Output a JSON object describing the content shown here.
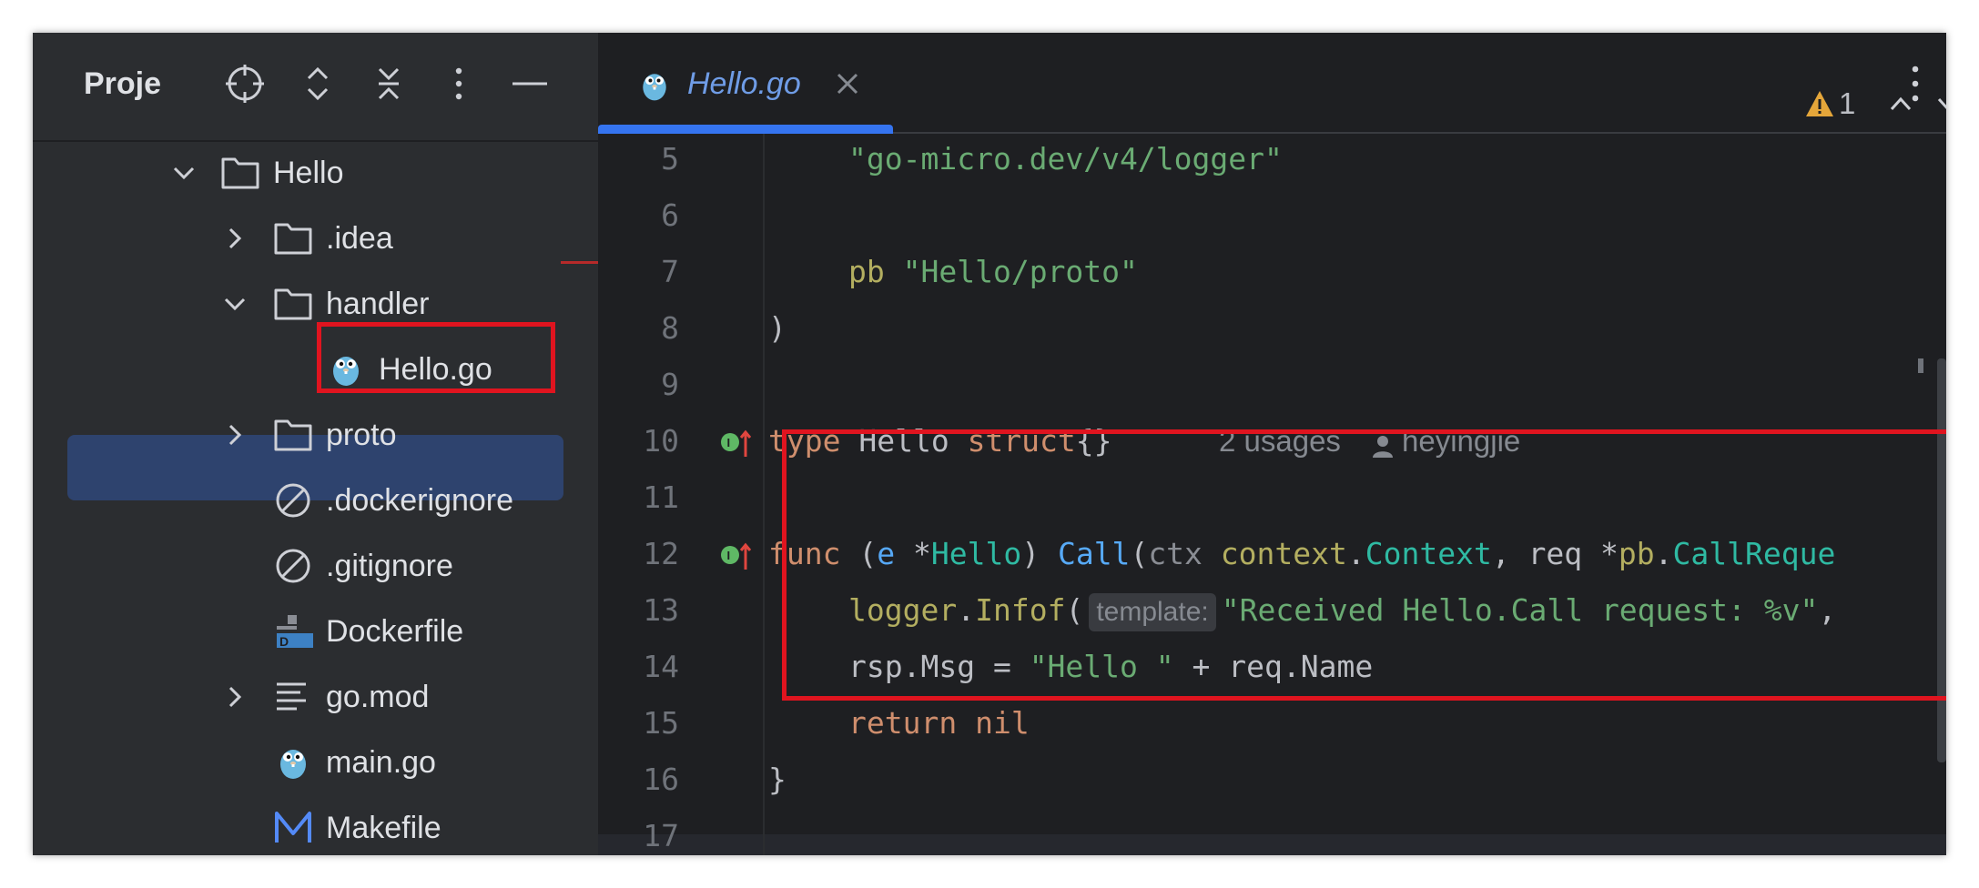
{
  "project_panel": {
    "title": "Proje",
    "toolbar_icons": [
      "crosshair-icon",
      "expand-all-icon",
      "collapse-all-icon",
      "more-vertical-icon",
      "minimize-icon"
    ],
    "tree": [
      {
        "label": "Hello",
        "icon": "folder-icon",
        "expanded": true
      },
      {
        "label": ".idea",
        "icon": "folder-icon",
        "expanded": false
      },
      {
        "label": "handler",
        "icon": "folder-icon",
        "expanded": true
      },
      {
        "label": "Hello.go",
        "icon": "gopher-icon",
        "selected": true
      },
      {
        "label": "proto",
        "icon": "folder-icon",
        "expanded": false
      },
      {
        "label": ".dockerignore",
        "icon": "ignore-file-icon"
      },
      {
        "label": ".gitignore",
        "icon": "ignore-file-icon"
      },
      {
        "label": "Dockerfile",
        "icon": "docker-file-icon"
      },
      {
        "label": "go.mod",
        "icon": "text-file-icon",
        "expanded": false
      },
      {
        "label": "main.go",
        "icon": "gopher-icon"
      },
      {
        "label": "Makefile",
        "icon": "makefile-icon"
      }
    ]
  },
  "editor": {
    "tab": {
      "label": "Hello.go",
      "icon": "gopher-icon"
    },
    "warnings": {
      "count": "1",
      "icon": "warning-icon"
    },
    "lines": [
      {
        "n": "5"
      },
      {
        "n": "6"
      },
      {
        "n": "7"
      },
      {
        "n": "8"
      },
      {
        "n": "9"
      },
      {
        "n": "10"
      },
      {
        "n": "11"
      },
      {
        "n": "12"
      },
      {
        "n": "13"
      },
      {
        "n": "14"
      },
      {
        "n": "15"
      },
      {
        "n": "16"
      },
      {
        "n": "17"
      }
    ],
    "code": {
      "l5_str": "\"go-micro.dev/v4/logger\"",
      "l7_pkg": "pb",
      "l7_str": "\"Hello/proto\"",
      "l8_paren": ")",
      "l10_kw": "type",
      "l10_name": " Hello ",
      "l10_struct": "struct",
      "l10_braces": "{}",
      "l10_usages": "2 usages",
      "l10_author": "heyingjie",
      "l12_func": "func",
      "l12_open": " (",
      "l12_recv": "e",
      "l12_star": " *",
      "l12_type": "Hello",
      "l12_close": ") ",
      "l12_name": "Call",
      "l12_p1": "(",
      "l12_ctx": "ctx",
      "l12_sp": " ",
      "l12_context": "context",
      "l12_dot": ".",
      "l12_Context": "Context",
      "l12_req": ", req *",
      "l12_pb": "pb",
      "l12_dot2": ".",
      "l12_CallReq": "CallReque",
      "l13_logger": "logger",
      "l13_dot": ".",
      "l13_infof": "Infof",
      "l13_paren": "(",
      "l13_hint": "template:",
      "l13_str": "\"Received Hello.Call request: %v\"",
      "l13_rest": ",",
      "l14_a": "rsp.Msg = ",
      "l14_str": "\"Hello \"",
      "l14_b": " + req.Name",
      "l15_return": "return",
      "l15_nil": " nil",
      "l16_brace": "}"
    }
  },
  "colors": {
    "accent": "#3574f0",
    "highlight_box": "#e0141f",
    "keyword": "#cf8e6d",
    "string": "#6aab73",
    "function": "#56a8f5"
  }
}
